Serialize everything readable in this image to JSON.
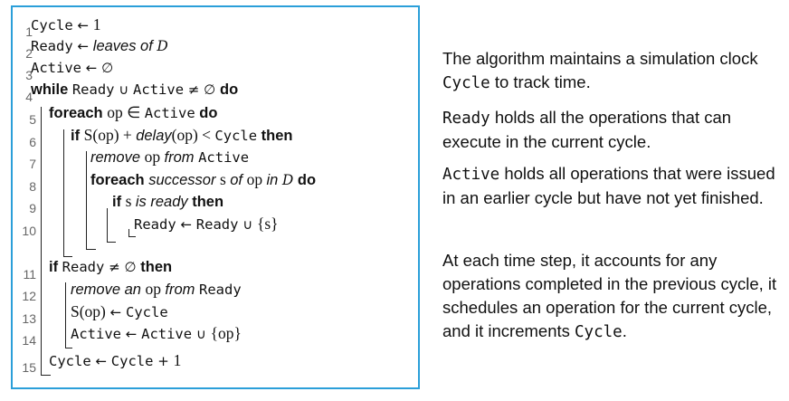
{
  "algorithm": {
    "lines": [
      {
        "num": "1",
        "tokens": [
          {
            "t": "mono",
            "s": "Cycle"
          },
          {
            "t": "op",
            "s": " ← "
          },
          {
            "t": "mi",
            "s": "1"
          }
        ]
      },
      {
        "num": "2",
        "tokens": [
          {
            "t": "mono",
            "s": "Ready"
          },
          {
            "t": "op",
            "s": " ← "
          },
          {
            "t": "it",
            "s": "leaves of "
          },
          {
            "t": "cal",
            "s": "D"
          }
        ]
      },
      {
        "num": "3",
        "tokens": [
          {
            "t": "mono",
            "s": "Active"
          },
          {
            "t": "op",
            "s": " ← ∅"
          }
        ]
      },
      {
        "num": "4",
        "tokens": [
          {
            "t": "kw",
            "s": "while "
          },
          {
            "t": "mono",
            "s": "Ready"
          },
          {
            "t": "op",
            "s": " ∪ "
          },
          {
            "t": "mono",
            "s": "Active"
          },
          {
            "t": "op",
            "s": " ≠ ∅ "
          },
          {
            "t": "kw",
            "s": "do"
          }
        ]
      },
      {
        "num": "5",
        "tokens": [
          {
            "t": "kw",
            "s": "foreach "
          },
          {
            "t": "mi",
            "s": "op ∈ "
          },
          {
            "t": "mono",
            "s": "Active"
          },
          {
            "t": "kw",
            "s": " do"
          }
        ]
      },
      {
        "num": "6",
        "tokens": [
          {
            "t": "kw",
            "s": "if "
          },
          {
            "t": "mi",
            "s": "S(op) + "
          },
          {
            "t": "it",
            "s": "delay"
          },
          {
            "t": "mi",
            "s": "(op) < "
          },
          {
            "t": "mono",
            "s": "Cycle"
          },
          {
            "t": "kw",
            "s": " then"
          }
        ]
      },
      {
        "num": "7",
        "tokens": [
          {
            "t": "it",
            "s": "remove "
          },
          {
            "t": "mi",
            "s": "op "
          },
          {
            "t": "it",
            "s": "from "
          },
          {
            "t": "mono",
            "s": "Active"
          }
        ]
      },
      {
        "num": "8",
        "tokens": [
          {
            "t": "kw",
            "s": "foreach "
          },
          {
            "t": "it",
            "s": "successor "
          },
          {
            "t": "mi",
            "s": "s "
          },
          {
            "t": "it",
            "s": "of "
          },
          {
            "t": "mi",
            "s": "op "
          },
          {
            "t": "it",
            "s": "in "
          },
          {
            "t": "cal",
            "s": "D"
          },
          {
            "t": "kw",
            "s": " do"
          }
        ]
      },
      {
        "num": "9",
        "tokens": [
          {
            "t": "kw",
            "s": "if "
          },
          {
            "t": "mi",
            "s": "s "
          },
          {
            "t": "it",
            "s": "is ready "
          },
          {
            "t": "kw",
            "s": "then"
          }
        ]
      },
      {
        "num": "10",
        "tokens": [
          {
            "t": "mono",
            "s": "Ready"
          },
          {
            "t": "op",
            "s": " ← "
          },
          {
            "t": "mono",
            "s": "Ready"
          },
          {
            "t": "op",
            "s": " ∪ "
          },
          {
            "t": "mi",
            "s": "{s}"
          }
        ]
      },
      {
        "num": "11",
        "tokens": [
          {
            "t": "kw",
            "s": "if "
          },
          {
            "t": "mono",
            "s": "Ready"
          },
          {
            "t": "op",
            "s": " ≠ ∅ "
          },
          {
            "t": "kw",
            "s": "then"
          }
        ]
      },
      {
        "num": "12",
        "tokens": [
          {
            "t": "it",
            "s": "remove an "
          },
          {
            "t": "mi",
            "s": "op "
          },
          {
            "t": "it",
            "s": "from "
          },
          {
            "t": "mono",
            "s": "Ready"
          }
        ]
      },
      {
        "num": "13",
        "tokens": [
          {
            "t": "mi",
            "s": "S(op)"
          },
          {
            "t": "op",
            "s": " ← "
          },
          {
            "t": "mono",
            "s": "Cycle"
          }
        ]
      },
      {
        "num": "14",
        "tokens": [
          {
            "t": "mono",
            "s": "Active"
          },
          {
            "t": "op",
            "s": " ← "
          },
          {
            "t": "mono",
            "s": "Active"
          },
          {
            "t": "op",
            "s": " ∪ "
          },
          {
            "t": "mi",
            "s": "{op}"
          }
        ]
      },
      {
        "num": "15",
        "tokens": [
          {
            "t": "mono",
            "s": "Cycle"
          },
          {
            "t": "op",
            "s": " ← "
          },
          {
            "t": "mono",
            "s": "Cycle"
          },
          {
            "t": "op",
            "s": " + "
          },
          {
            "t": "mi",
            "s": "1"
          }
        ]
      }
    ]
  },
  "explanation": [
    [
      {
        "t": "plain",
        "s": "The algorithm maintains a simulation clock "
      },
      {
        "t": "mono",
        "s": "Cycle"
      },
      {
        "t": "plain",
        "s": " to track time."
      }
    ],
    [
      {
        "t": "mono",
        "s": "Ready"
      },
      {
        "t": "plain",
        "s": " holds all the operations that can execute in the current cycle."
      }
    ],
    [
      {
        "t": "mono",
        "s": "Active"
      },
      {
        "t": "plain",
        "s": " holds all operations that were issued in an earlier cycle but have not yet finished."
      }
    ],
    [
      {
        "t": "plain",
        "s": "At each time step, it accounts for any operations completed in the previous cycle, it schedules an operation for the current cycle, and it increments "
      },
      {
        "t": "mono",
        "s": "Cycle"
      },
      {
        "t": "plain",
        "s": "."
      }
    ]
  ]
}
